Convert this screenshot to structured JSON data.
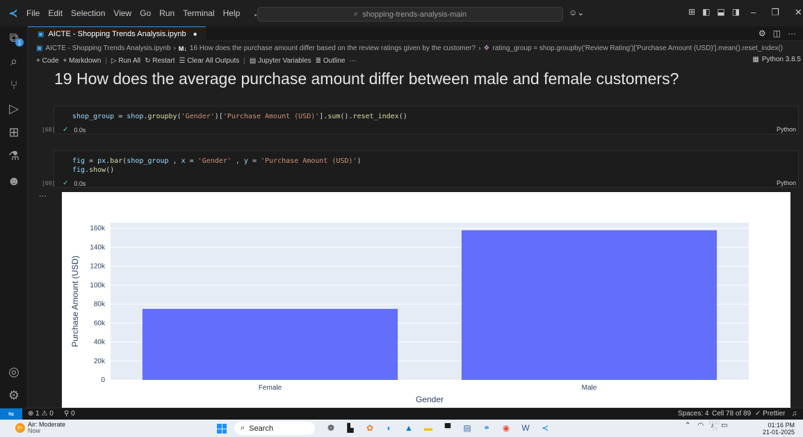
{
  "titlebar": {
    "menu": [
      "File",
      "Edit",
      "Selection",
      "View",
      "Go",
      "Run",
      "Terminal",
      "Help"
    ],
    "command_center": "shopping-trends-analysis-main"
  },
  "tab": {
    "label": "AICTE - Shopping Trends Analysis.ipynb"
  },
  "breadcrumb": {
    "file": "AICTE - Shopping Trends Analysis.ipynb",
    "md_badge": "M↓",
    "section": "16 How does the purchase amount differ based on the review ratings given by the customer?",
    "symbol": "rating_group = shop.groupby('Review Rating')['Purchase Amount (USD)'].mean().reset_index()"
  },
  "toolbar": {
    "code": "Code",
    "markdown": "Markdown",
    "run_all": "Run All",
    "restart": "Restart",
    "clear_outputs": "Clear All Outputs",
    "variables": "Jupyter Variables",
    "outline": "Outline",
    "more": "···",
    "kernel": "Python 3.8.5"
  },
  "heading": "19 How does the average purchase amount differ between male and female customers?",
  "cells": [
    {
      "exec": "[68]",
      "time": "0.0s",
      "lang": "Python",
      "line1": {
        "a": "shop_group",
        "b": " = ",
        "c": "shop",
        "d": ".",
        "e": "groupby",
        "f": "(",
        "g": "'Gender'",
        "h": ")[",
        "i": "'Purchase Amount (USD)'",
        "j": "].",
        "k": "sum",
        "l": "().",
        "m": "reset_index",
        "n": "()"
      }
    },
    {
      "exec": "[69]",
      "time": "0.0s",
      "lang": "Python",
      "line1": {
        "a": "fig",
        "b": " = ",
        "c": "px",
        "d": ".",
        "e": "bar",
        "f": "(",
        "g": "shop_group",
        "h": " , ",
        "i": "x",
        "j": " = ",
        "k": "'Gender'",
        "l": " , ",
        "m": "y",
        "n": " = ",
        "o": "'Purchase Amount (USD)'",
        "p": ")"
      },
      "line2": {
        "a": "fig",
        "b": ".",
        "c": "show",
        "d": "()"
      }
    }
  ],
  "output_ellipsis": "···",
  "chart_data": {
    "type": "bar",
    "categories": [
      "Female",
      "Male"
    ],
    "values": [
      75000,
      158000
    ],
    "xlabel": "Gender",
    "ylabel": "Purchase Amount (USD)",
    "ylim": [
      0,
      166000
    ],
    "yticks": [
      0,
      20000,
      40000,
      60000,
      80000,
      100000,
      120000,
      140000,
      160000
    ],
    "ytick_labels": [
      "0",
      "20k",
      "40k",
      "60k",
      "80k",
      "100k",
      "120k",
      "140k",
      "160k"
    ],
    "bar_color": "#636efa",
    "plot_bg": "#e5ecf6",
    "grid": true
  },
  "statusbar": {
    "errors": "1",
    "warnings": "0",
    "ports": "0",
    "spaces": "Spaces: 4",
    "cell": "Cell 78 of 89",
    "prettier": "Prettier"
  },
  "taskbar": {
    "weather_badge": "9+",
    "weather_title": "Air: Moderate",
    "weather_sub": "Now",
    "search": "Search",
    "lang_top": "ENG",
    "lang_bottom": "IN",
    "time": "01:16 PM",
    "date": "21-01-2025"
  },
  "colors": {
    "accent": "#0078d4",
    "bar": "#636efa"
  }
}
